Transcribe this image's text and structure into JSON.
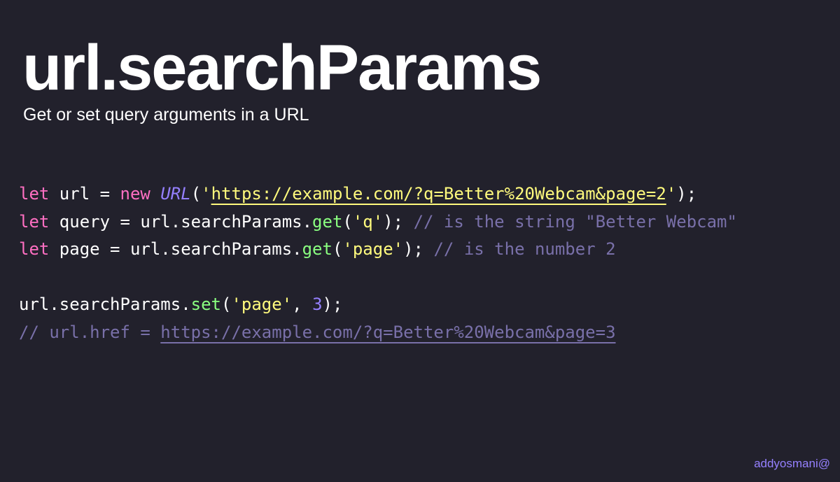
{
  "slide": {
    "title": "url.searchParams",
    "subtitle": "Get or set query arguments in a URL",
    "footer": "addyosmani@"
  },
  "code": {
    "line1": {
      "kw_let": "let",
      "var": " url = ",
      "kw_new": "new",
      "space": " ",
      "cls": "URL",
      "open": "(",
      "quote_open": "'",
      "url": "https://example.com/?q=Better%20Webcam&page=2",
      "quote_close": "'",
      "close": ");"
    },
    "line2": {
      "kw_let": "let",
      "var": " query = url.searchParams.",
      "fn": "get",
      "open": "(",
      "str": "'q'",
      "close": "); ",
      "comment": "// is the string \"Better Webcam\""
    },
    "line3": {
      "kw_let": "let",
      "var": " page = url.searchParams.",
      "fn": "get",
      "open": "(",
      "str": "'page'",
      "close": "); ",
      "comment": "// is the number 2"
    },
    "line5": {
      "prefix": "url.searchParams.",
      "fn": "set",
      "open": "(",
      "str": "'page'",
      "sep": ", ",
      "num": "3",
      "close": ");"
    },
    "line6": {
      "comment_prefix": "// url.href = ",
      "comment_url": "https://example.com/?q=Better%20Webcam&page=3"
    }
  },
  "colors": {
    "background": "#22212c",
    "keyword": "#ff6fc2",
    "class": "#9580ff",
    "string": "#fffa7d",
    "function": "#8aff80",
    "number": "#9580ff",
    "comment": "#7970a9",
    "footer": "#9580ff"
  }
}
